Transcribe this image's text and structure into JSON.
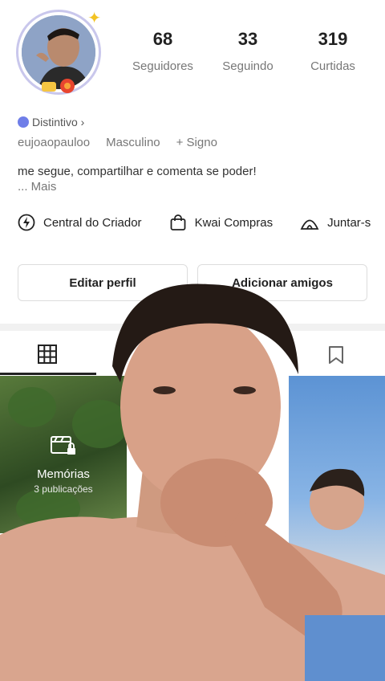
{
  "profile": {
    "stats": [
      {
        "number": "68",
        "label": "Seguidores"
      },
      {
        "number": "33",
        "label": "Seguindo"
      },
      {
        "number": "319",
        "label": "Curtidas"
      }
    ],
    "badge": "Distintivo ›",
    "username": "eujoaopauloo",
    "gender": "Masculino",
    "sign": "+ Signo",
    "bio": "me segue, compartilhar e comenta se poder!",
    "more": "...  Mais"
  },
  "shortcuts": [
    {
      "label": "Central do Criador",
      "icon": "lightning-icon"
    },
    {
      "label": "Kwai Compras",
      "icon": "shopping-bag-icon"
    },
    {
      "label": "Juntar-s",
      "icon": "tent-icon"
    }
  ],
  "buttons": {
    "edit": "Editar perfil",
    "add_friends": "Adicionar amigos"
  },
  "tabs": {
    "active": "grid",
    "icons": [
      "grid-icon",
      "bookmark-icon"
    ]
  },
  "grid": {
    "memories_title": "Memórias",
    "memories_sub": "3 publicações"
  },
  "colors": {
    "badge": "#6f7ee8",
    "avatar_ring": "#c9c7ec",
    "tab_active": "#222222"
  }
}
